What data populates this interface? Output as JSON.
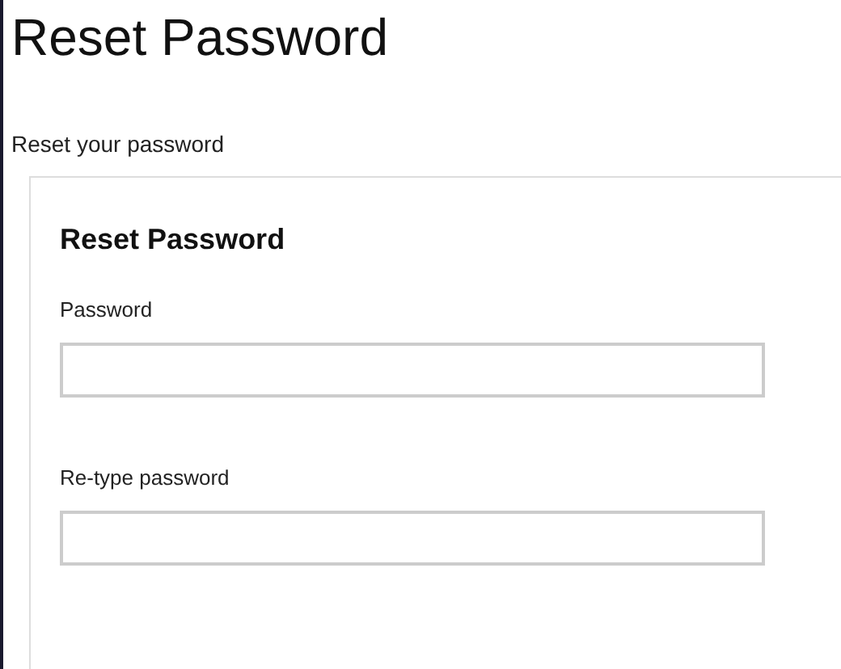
{
  "page": {
    "title": "Reset Password",
    "subtitle": "Reset your password"
  },
  "form": {
    "title": "Reset Password",
    "fields": [
      {
        "label": "Password"
      },
      {
        "label": "Re-type password"
      }
    ]
  }
}
